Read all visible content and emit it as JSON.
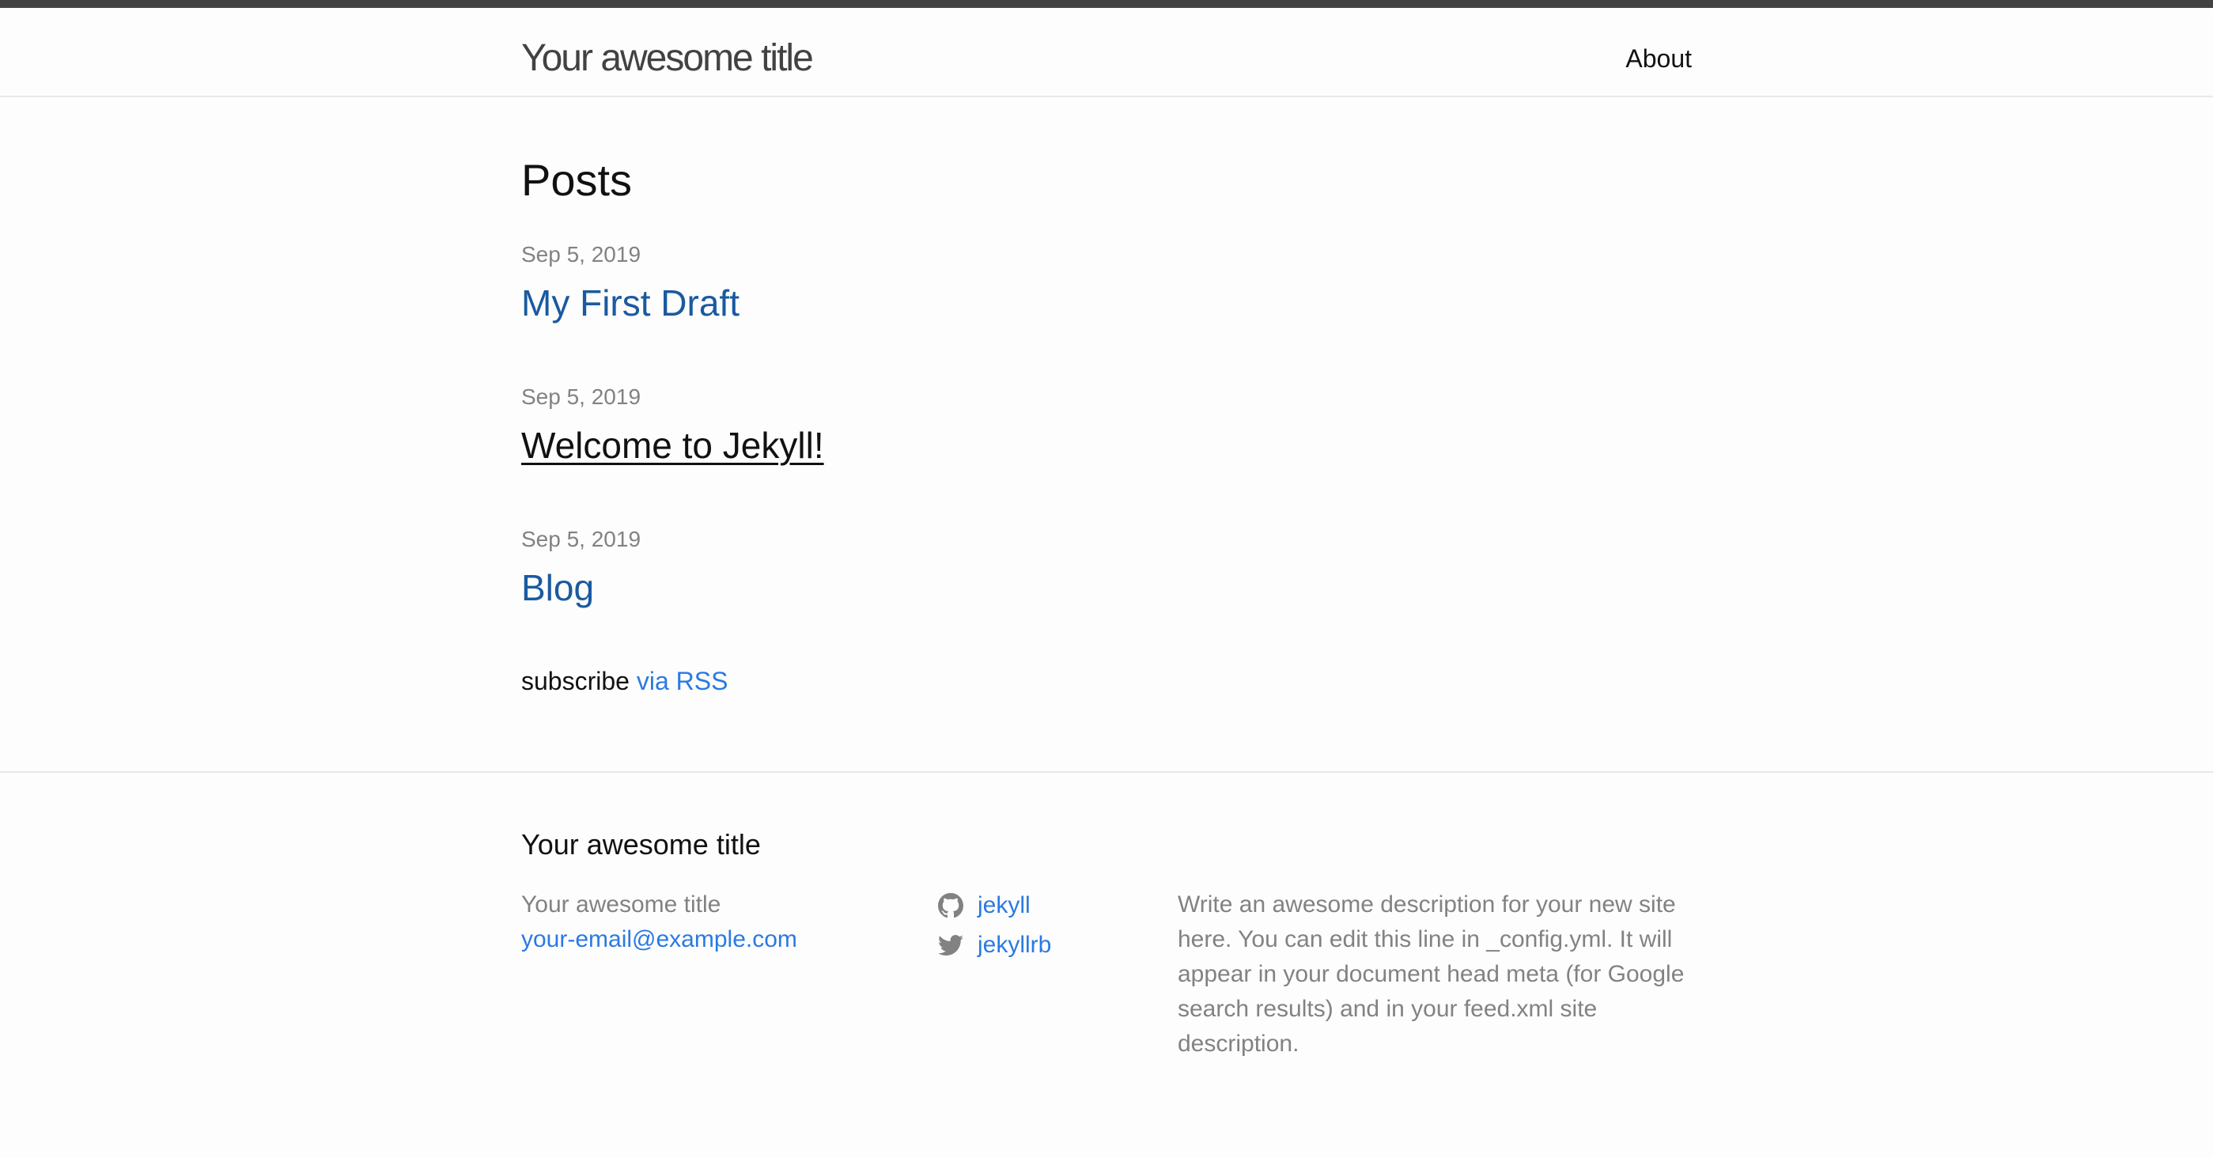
{
  "header": {
    "site_title": "Your awesome title",
    "nav": [
      {
        "label": "About"
      }
    ]
  },
  "main": {
    "heading": "Posts",
    "posts": [
      {
        "date": "Sep 5, 2019",
        "title": "My First Draft"
      },
      {
        "date": "Sep 5, 2019",
        "title": "Welcome to Jekyll!"
      },
      {
        "date": "Sep 5, 2019",
        "title": "Blog"
      }
    ],
    "subscribe_text": "subscribe",
    "subscribe_link": "via RSS"
  },
  "footer": {
    "heading": "Your awesome title",
    "contact_name": "Your awesome title",
    "contact_email": "your-email@example.com",
    "social": [
      {
        "icon": "github-icon",
        "label": "jekyll"
      },
      {
        "icon": "twitter-icon",
        "label": "jekyllrb"
      }
    ],
    "description": "Write an awesome description for your new site here. You can edit this line in _config.yml. It will appear in your document head meta (for Google search results) and in your feed.xml site description."
  },
  "colors": {
    "link": "#2a7ae2",
    "post_link": "#1a5aa0",
    "muted_text": "#828282",
    "header_title": "#424242",
    "top_bar": "#424242",
    "border": "#e8e8e8",
    "background": "#fdfdfd"
  }
}
